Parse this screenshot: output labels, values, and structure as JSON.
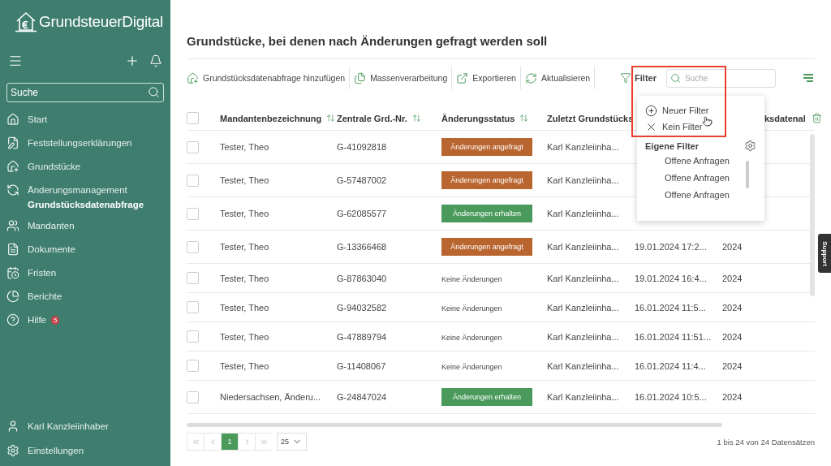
{
  "sidebar": {
    "logo": "GrundsteuerDigital",
    "search": {
      "placeholder": "Suche"
    },
    "items": [
      {
        "label": "Start",
        "selected": false
      },
      {
        "label": "Feststellungserklärungen",
        "selected": false
      },
      {
        "label": "Grundstücke",
        "selected": false
      },
      {
        "label": "Änderungsmanagement",
        "selected": false,
        "children": [
          {
            "label": "Grundstücksdatenabfrage",
            "selected": true
          }
        ]
      },
      {
        "label": "Mandanten",
        "selected": false
      },
      {
        "label": "Dokumente",
        "selected": false
      },
      {
        "label": "Fristen",
        "selected": false
      },
      {
        "label": "Berichte",
        "selected": false
      },
      {
        "label": "Hilfe",
        "selected": false,
        "badge": "5"
      }
    ],
    "bottom_items": [
      "Karl Kanzleiinhaber",
      "Einstellungen"
    ]
  },
  "page_title": "Grundstücke, bei denen nach Änderungen gefragt werden soll",
  "toolbar": {
    "actions": [
      "Grundstücksdatenabfrage hinzufügen",
      "Massenverarbeitung",
      "Exportieren",
      "Aktualisieren"
    ],
    "filter_label": "Filter",
    "search": {
      "placeholder": "Suche"
    }
  },
  "filter_menu": {
    "items": [
      "Neuer Filter",
      "Kein Filter"
    ],
    "section": "Eigene Filter",
    "saved": [
      "Offene Anfragen",
      "Offene Anfragen",
      "Offene Anfragen"
    ]
  },
  "table": {
    "select_all_checked": false,
    "columns": [
      "Mandantenbezeichnung",
      "Zentrale Grd.-Nr.",
      "Änderungsstatus",
      "Zuletzt Grundstücks",
      "ksdatenal"
    ],
    "rows": [
      {
        "checked": false,
        "cells": [
          "Tester, Theo",
          "G-41092818",
          {
            "kind": "requested",
            "text": "Änderungen angefragt"
          },
          "Karl Kanzleiinha..."
        ]
      },
      {
        "checked": false,
        "cells": [
          "Tester, Theo",
          "G-57487002",
          {
            "kind": "requested",
            "text": "Änderungen angefragt"
          },
          "Karl Kanzleiinha..."
        ]
      },
      {
        "checked": false,
        "cells": [
          "Tester, Theo",
          "G-62085577",
          {
            "kind": "received",
            "text": "Änderungen erhalten"
          },
          "Karl Kanzleiinha..."
        ]
      },
      {
        "checked": false,
        "cells": [
          "Tester, Theo",
          "G-13366468",
          {
            "kind": "requested",
            "text": "Änderungen angefragt"
          },
          "Karl Kanzleiinha...",
          "19.01.2024 17:2...",
          "2024"
        ]
      },
      {
        "checked": false,
        "cells": [
          "Tester, Theo",
          "G-87863040",
          {
            "kind": "none",
            "text": "Keine Änderungen"
          },
          "Karl Kanzleiinha...",
          "19.01.2024 16:4...",
          "2024"
        ]
      },
      {
        "checked": false,
        "cells": [
          "Tester, Theo",
          "G-94032582",
          {
            "kind": "none",
            "text": "Keine Änderungen"
          },
          "Karl Kanzleiinha...",
          "16.01.2024 11:5...",
          "2024"
        ]
      },
      {
        "checked": false,
        "cells": [
          "Tester, Theo",
          "G-47889794",
          {
            "kind": "none",
            "text": "Keine Änderungen"
          },
          "Karl Kanzleiinha...",
          "16.01.2024 11:51...",
          "2024"
        ]
      },
      {
        "checked": false,
        "cells": [
          "Tester, Theo",
          "G-11408067",
          {
            "kind": "none",
            "text": "Keine Änderungen"
          },
          "Karl Kanzleiinha...",
          "16.01.2024 11:4...",
          "2024"
        ]
      },
      {
        "checked": false,
        "cells": [
          "Niedersachsen, Änderu...",
          "G-24847024",
          {
            "kind": "received",
            "text": "Änderungen erhalten"
          },
          "Karl Kanzleiinha...",
          "16.01.2024 10:5...",
          "2024"
        ]
      }
    ]
  },
  "pagination": {
    "pages": [
      {
        "label": "1",
        "selected": true
      }
    ],
    "page_size": "25",
    "summary": "1 bis 24 von 24 Datensätzen"
  },
  "support_tab": "Support"
}
